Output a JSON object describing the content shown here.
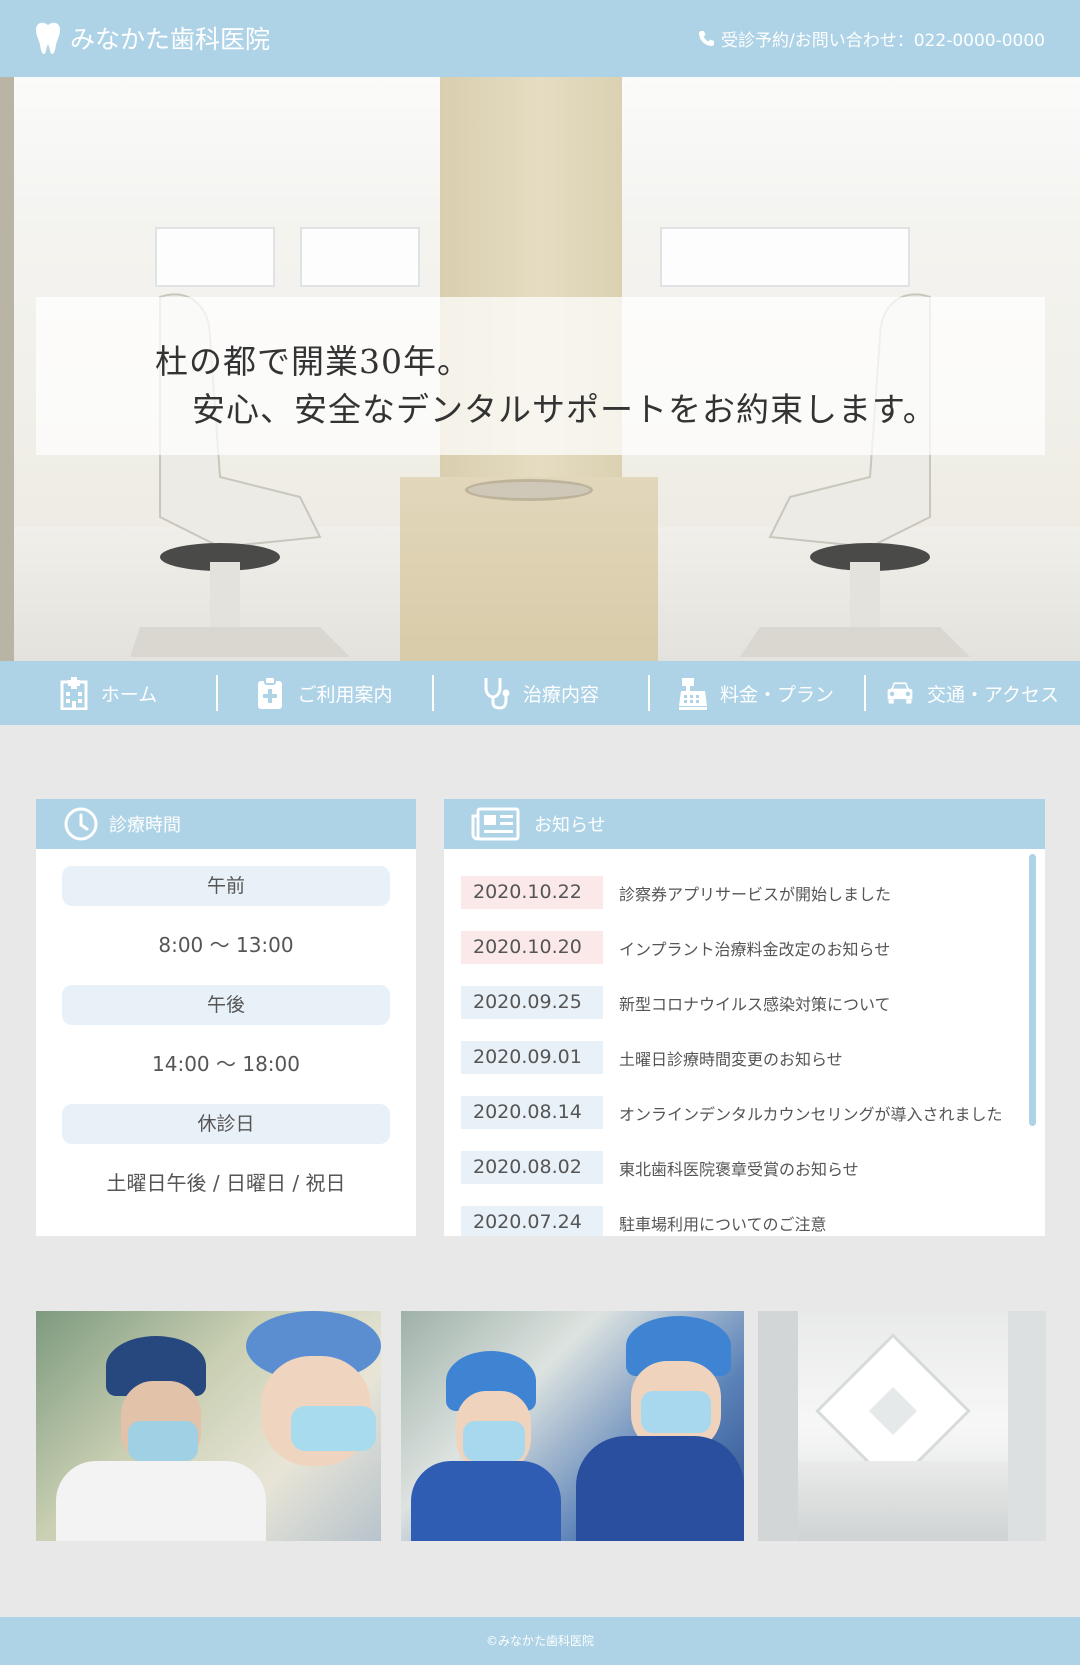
{
  "header": {
    "logo_text": "みなかた歯科医院",
    "contact_text": "受診予約/お問い合わせ：022-0000-0000"
  },
  "hero": {
    "line1": "杜の都で開業30年。",
    "line2": "安心、安全なデンタルサポートをお約束します。"
  },
  "nav": {
    "items": [
      {
        "label": "ホーム",
        "icon": "hospital-icon"
      },
      {
        "label": "ご利用案内",
        "icon": "clipboard-icon"
      },
      {
        "label": "治療内容",
        "icon": "stethoscope-icon"
      },
      {
        "label": "料金・プラン",
        "icon": "cash-register-icon"
      },
      {
        "label": "交通・アクセス",
        "icon": "car-icon"
      }
    ]
  },
  "hours": {
    "title": "診療時間",
    "morning_label": "午前",
    "morning_time": "8:00 〜 13:00",
    "afternoon_label": "午後",
    "afternoon_time": "14:00 〜 18:00",
    "closed_label": "休診日",
    "closed_days": "土曜日午後 / 日曜日 / 祝日"
  },
  "news": {
    "title": "お知らせ",
    "items": [
      {
        "date": "2020.10.22",
        "title": "診察券アプリサービスが開始しました"
      },
      {
        "date": "2020.10.20",
        "title": "インプラント治療料金改定のお知らせ"
      },
      {
        "date": "2020.09.25",
        "title": "新型コロナウイルス感染対策について"
      },
      {
        "date": "2020.09.01",
        "title": "土曜日診療時間変更のお知らせ"
      },
      {
        "date": "2020.08.14",
        "title": "オンラインデンタルカウンセリングが導入されました"
      },
      {
        "date": "2020.08.02",
        "title": "東北歯科医院褒章受賞のお知らせ"
      },
      {
        "date": "2020.07.24",
        "title": "駐車場利用についてのご注意"
      }
    ]
  },
  "colors": {
    "accent": "#aed3e6",
    "pill": "#e9f1f8",
    "new_badge": "#fbe9ea",
    "background": "#e8e8e8"
  },
  "footer": {
    "copyright": "©みなかた歯科医院"
  }
}
